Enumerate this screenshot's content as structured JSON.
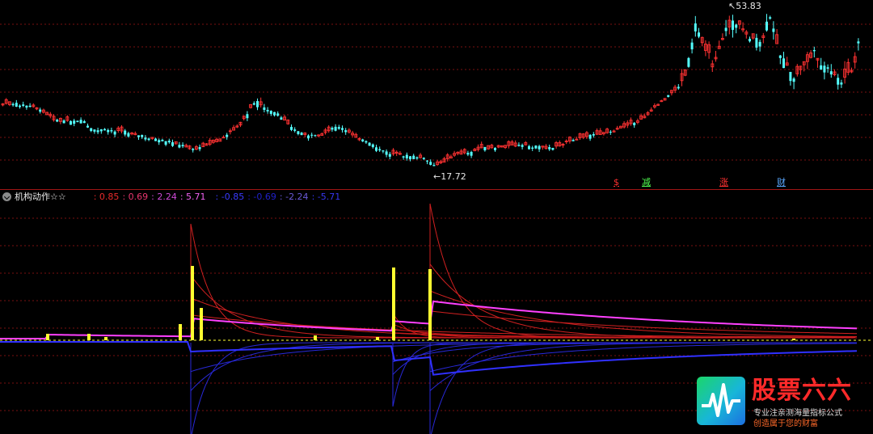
{
  "indicator": {
    "name": "机构动作☆☆",
    "values": [
      {
        "text": ": 0.85",
        "color": "#e82b2b"
      },
      {
        "text": ": 0.69",
        "color": "#e8366e"
      },
      {
        "text": ": 2.24",
        "color": "#d04ad8"
      },
      {
        "text": ": 5.71",
        "color": "#f060f0"
      },
      {
        "text": ": -0.85",
        "color": "#3a3aff"
      },
      {
        "text": ": -0.69",
        "color": "#2020c8"
      },
      {
        "text": ": -2.24",
        "color": "#6a5ad8"
      },
      {
        "text": ": -5.71",
        "color": "#3636f0"
      }
    ]
  },
  "price": {
    "high_label": "53.83",
    "low_label": "17.72",
    "high_value": 53.83,
    "low_value": 17.72,
    "up_color": "#ff3232",
    "down_color": "#54ffff"
  },
  "signals": [
    {
      "text": "$",
      "color": "#ff3030"
    },
    {
      "text": "减",
      "color": "#50ff50"
    },
    {
      "text": "涨",
      "color": "#ff3030"
    },
    {
      "text": "财",
      "color": "#5aa8ff"
    }
  ],
  "colors": {
    "grid": "#7a1010",
    "separator": "#a01515",
    "yellow": "#ffff30",
    "magenta": "#ff40ff",
    "blue": "#3030ff",
    "red": "#d02020"
  },
  "logo": {
    "title": "股票六六",
    "subtitle1": "专业注亲测海量指标公式",
    "subtitle2": "创造属于您的财富"
  }
}
